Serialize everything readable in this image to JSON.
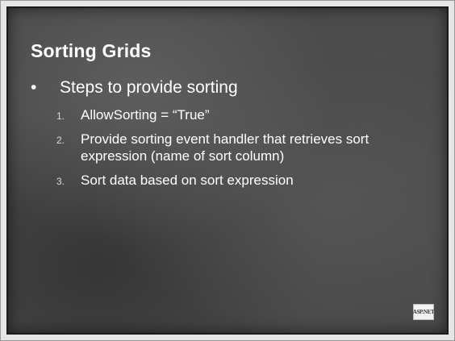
{
  "slide": {
    "title": "Sorting Grids",
    "bullet": {
      "symbol": "•",
      "text": "Steps to provide sorting"
    },
    "steps": [
      {
        "number": "1.",
        "text": "AllowSorting = “True”"
      },
      {
        "number": "2.",
        "text": "Provide sorting event handler that retrieves sort expression (name of sort column)"
      },
      {
        "number": "3.",
        "text": "Sort data based on sort expression"
      }
    ],
    "logo": {
      "icon": "aspnet-logo-icon",
      "text": "ASP.NET"
    }
  },
  "colors": {
    "background": "#4a4a4a",
    "text": "#ffffff",
    "border": "#1a1a1a"
  }
}
